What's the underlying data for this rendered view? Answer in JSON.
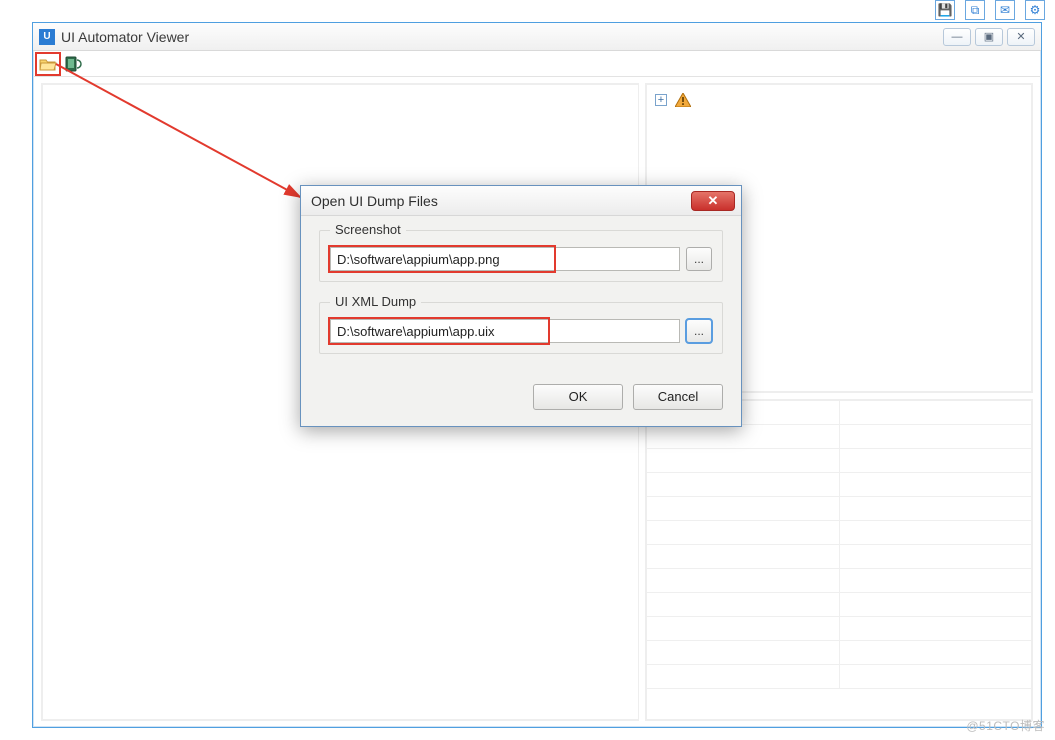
{
  "external_icons": [
    "save-icon",
    "copy-icon",
    "mail-icon",
    "gear-icon"
  ],
  "window": {
    "title": "UI Automator Viewer",
    "controls": {
      "min": "—",
      "max": "▣",
      "close": "✕"
    }
  },
  "toolbar": {
    "open_tooltip": "Open",
    "device_tooltip": "Device Screenshot"
  },
  "tree": {
    "expand_glyph": "+",
    "warning_label": "warning"
  },
  "dialog": {
    "title": "Open UI Dump Files",
    "close_glyph": "✕",
    "groups": {
      "screenshot": {
        "legend": "Screenshot",
        "value": "D:\\software\\appium\\app.png",
        "browse": "..."
      },
      "uixml": {
        "legend": "UI XML Dump",
        "value": "D:\\software\\appium\\app.uix",
        "browse": "..."
      }
    },
    "buttons": {
      "ok": "OK",
      "cancel": "Cancel"
    }
  },
  "watermark": "@51CTO博客"
}
